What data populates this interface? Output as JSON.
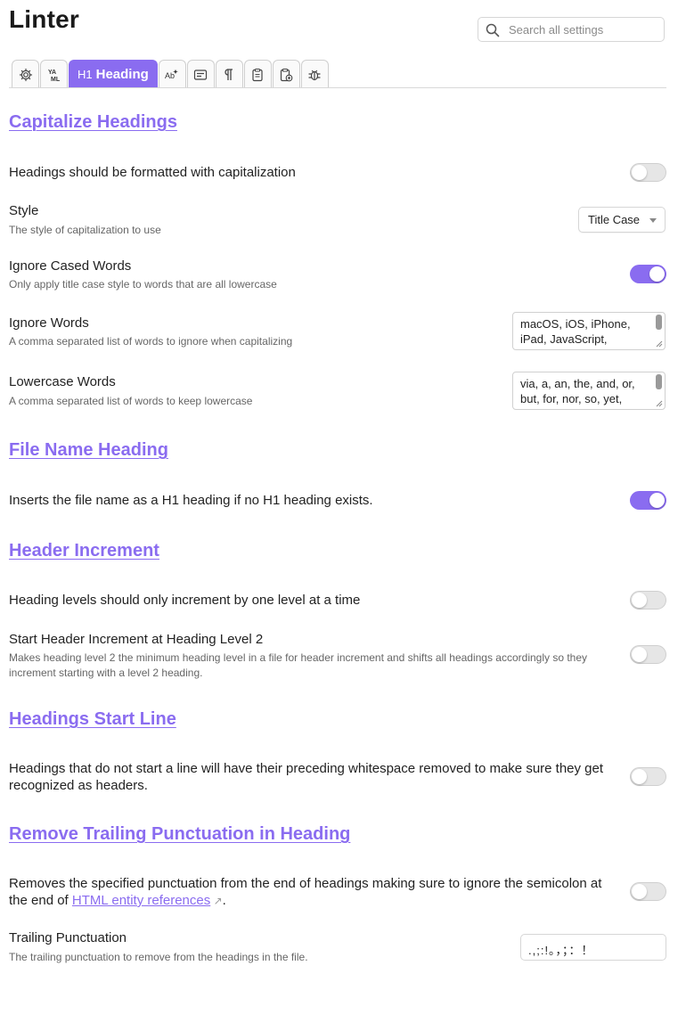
{
  "app": {
    "title": "Linter"
  },
  "search": {
    "placeholder": "Search all settings"
  },
  "tabs": [
    {
      "icon": "gear-icon"
    },
    {
      "icon": "yaml-icon",
      "label": "YA ML"
    },
    {
      "icon": "h1-icon",
      "prefix": "H1",
      "label": "Heading",
      "active": true
    },
    {
      "icon": "spellcheck-icon"
    },
    {
      "icon": "content-icon"
    },
    {
      "icon": "pilcrow-icon"
    },
    {
      "icon": "clipboard-icon"
    },
    {
      "icon": "paste-icon"
    },
    {
      "icon": "debug-icon"
    }
  ],
  "sections": {
    "capitalize": {
      "title": "Capitalize Headings",
      "enable": {
        "label": "Headings should be formatted with capitalization",
        "on": false
      },
      "style": {
        "label": "Style",
        "desc": "The style of capitalization to use",
        "value": "Title Case"
      },
      "ignore_cased": {
        "label": "Ignore Cased Words",
        "desc": "Only apply title case style to words that are all lowercase",
        "on": true
      },
      "ignore_words": {
        "label": "Ignore Words",
        "desc": "A comma separated list of words to ignore when capitalizing",
        "value": "macOS, iOS, iPhone, iPad, JavaScript,"
      },
      "lowercase_words": {
        "label": "Lowercase Words",
        "desc": "A comma separated list of words to keep lowercase",
        "value": "via, a, an, the, and, or, but, for, nor, so, yet,"
      }
    },
    "file_name": {
      "title": "File Name Heading",
      "enable": {
        "label": "Inserts the file name as a H1 heading if no H1 heading exists.",
        "on": true
      }
    },
    "header_increment": {
      "title": "Header Increment",
      "enable": {
        "label": "Heading levels should only increment by one level at a time",
        "on": false
      },
      "start_level2": {
        "label": "Start Header Increment at Heading Level 2",
        "desc": "Makes heading level 2 the minimum heading level in a file for header increment and shifts all headings accordingly so they increment starting with a level 2 heading.",
        "on": false
      }
    },
    "start_line": {
      "title": "Headings Start Line",
      "enable": {
        "label": "Headings that do not start a line will have their preceding whitespace removed to make sure they get recognized as headers.",
        "on": false
      }
    },
    "trailing": {
      "title": "Remove Trailing Punctuation in Heading",
      "enable": {
        "label_before": "Removes the specified punctuation from the end of headings making sure to ignore the semicolon at the end of ",
        "link": "HTML entity references",
        "label_after": ".",
        "on": false
      },
      "punctuation": {
        "label": "Trailing Punctuation",
        "desc": "The trailing punctuation to remove from the headings in the file.",
        "value": ".,;:!。，；：！"
      }
    }
  }
}
